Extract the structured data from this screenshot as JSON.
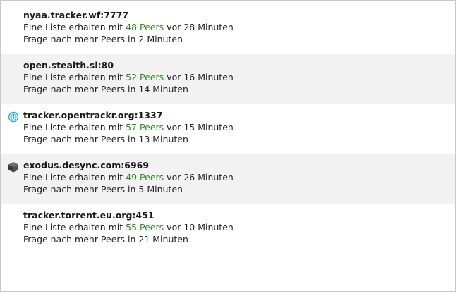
{
  "trackers": [
    {
      "name": "nyaa.tracker.wf:7777",
      "icon": "",
      "got_prefix": "Eine Liste erhalten mit",
      "peers": "48 Peers",
      "got_suffix": "vor 28 Minuten",
      "next_announce": "Frage nach mehr Peers in 2 Minuten"
    },
    {
      "name": "open.stealth.si:80",
      "icon": "",
      "got_prefix": "Eine Liste erhalten mit",
      "peers": "52 Peers",
      "got_suffix": "vor 16 Minuten",
      "next_announce": "Frage nach mehr Peers in 14 Minuten"
    },
    {
      "name": "tracker.opentrackr.org:1337",
      "icon": "opentrackr-favicon-icon",
      "got_prefix": "Eine Liste erhalten mit",
      "peers": "57 Peers",
      "got_suffix": "vor 15 Minuten",
      "next_announce": "Frage nach mehr Peers in 13 Minuten"
    },
    {
      "name": "exodus.desync.com:6969",
      "icon": "cube-favicon-icon",
      "got_prefix": "Eine Liste erhalten mit",
      "peers": "49 Peers",
      "got_suffix": "vor 26 Minuten",
      "next_announce": "Frage nach mehr Peers in 5 Minuten"
    },
    {
      "name": "tracker.torrent.eu.org:451",
      "icon": "",
      "got_prefix": "Eine Liste erhalten mit",
      "peers": "55 Peers",
      "got_suffix": "vor 10 Minuten",
      "next_announce": "Frage nach mehr Peers in 21 Minuten"
    }
  ],
  "colors": {
    "peers_accent": "#2e8b22",
    "alt_row_background": "#f2f2f2",
    "opentrackr_icon": "#29a8e0"
  }
}
